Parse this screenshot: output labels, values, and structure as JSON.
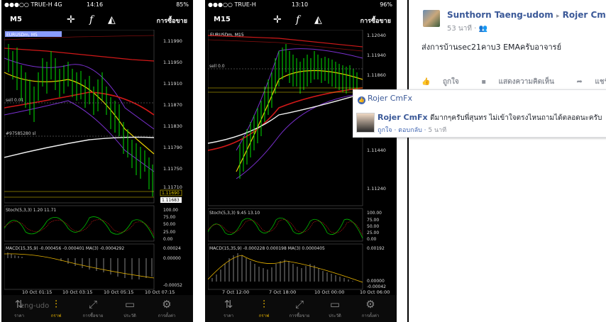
{
  "phone1": {
    "status": {
      "carrier": "●●●○○ TRUE-H  4G",
      "time": "14:16",
      "battery": "85%"
    },
    "timeframe": "M5",
    "trade_label": "การซื้อขาย",
    "symbol": "EURUSDm, M5",
    "sell_label": "sell 0.01",
    "order_label": "#97585280 sl",
    "stoch_label": "Stoch(5,3,3) 1.20 11.71",
    "macd_label": "MACD(15,35,9) -0.000456 -0.000401 MA(3) -0.0004292",
    "price_ticks": [
      "1.11990",
      "1.11950",
      "1.11910",
      "1.11870",
      "1.11830",
      "1.11790",
      "1.11750",
      "1.11710"
    ],
    "price_tag_1": "1.11690",
    "price_tag_2": "1.11683",
    "stoch_ticks": [
      "100.00",
      "75.00",
      "50.00",
      "25.00",
      "0.00"
    ],
    "macd_ticks": [
      "0.00024",
      "0.00000",
      "-0.00052"
    ],
    "time_ticks": [
      "10 Oct 01:15",
      "10 Oct 03:15",
      "10 Oct 05:15",
      "10 Oct 07:15"
    ]
  },
  "phone2": {
    "status": {
      "carrier": "●●●○○ TRUE-H",
      "time": "13:10",
      "battery": "96%"
    },
    "timeframe": "M15",
    "trade_label": "การซื้อขาย",
    "symbol": "EURUSDm, M15",
    "sell_label": "sell 0.0",
    "stoch_label": "Stoch(5,3,3) 9.45 13.10",
    "macd_label": "MACD(15,35,9) -0.000228 0.000198 MA(3) 0.0000405",
    "price_ticks": [
      "1.12040",
      "1.11940",
      "1.11860",
      "1.11440",
      "1.11240"
    ],
    "stoch_ticks": [
      "100.00",
      "75.00",
      "50.00",
      "25.00",
      "0.00"
    ],
    "macd_ticks": [
      "0.00192",
      "0.00000",
      "-0.00042"
    ],
    "time_ticks": [
      "7 Oct 12:00",
      "7 Oct 18:00",
      "10 Oct 00:00",
      "10 Oct 06:00"
    ]
  },
  "tabs": [
    {
      "label": "ราคา",
      "icon": "quotes-icon"
    },
    {
      "label": "กราฟ",
      "icon": "chart-icon"
    },
    {
      "label": "การซื้อขาย",
      "icon": "trade-icon"
    },
    {
      "label": "ประวัติ",
      "icon": "history-icon"
    },
    {
      "label": "การตั้งค่า",
      "icon": "settings-icon"
    }
  ],
  "phone1_tab_overlay": "eng-udo",
  "facebook": {
    "author": "Sunthorn Taeng-udom",
    "arrow": "▸",
    "target": "Rojer CmFx",
    "time": "53 นาที",
    "text": "ส่งการบ้านsec21คาบ3 EMAครับอาจารย์",
    "like": "ถูกใจ",
    "comment": "แสดงความคิดเห็น",
    "share": "แชร์",
    "notif_header": "Rojer CmFx",
    "reply_name": "Rojer CmFx",
    "reply_text": "ดีมากๆครับพี่สุนทร ไม่เข้าใจตรงไหนถามได้ตลอดนะครับ",
    "reply_like": "ถูกใจ",
    "reply_reply": "ตอบกลับ",
    "reply_time": "5 นาที"
  },
  "colors": {
    "bull": "#00e000",
    "ma_red": "#d01818",
    "ma_yellow": "#e8d000",
    "ma_white": "#f0f0f0",
    "band": "#7a30d0",
    "fb_blue": "#3b5998",
    "active_tab": "#e8b400"
  }
}
